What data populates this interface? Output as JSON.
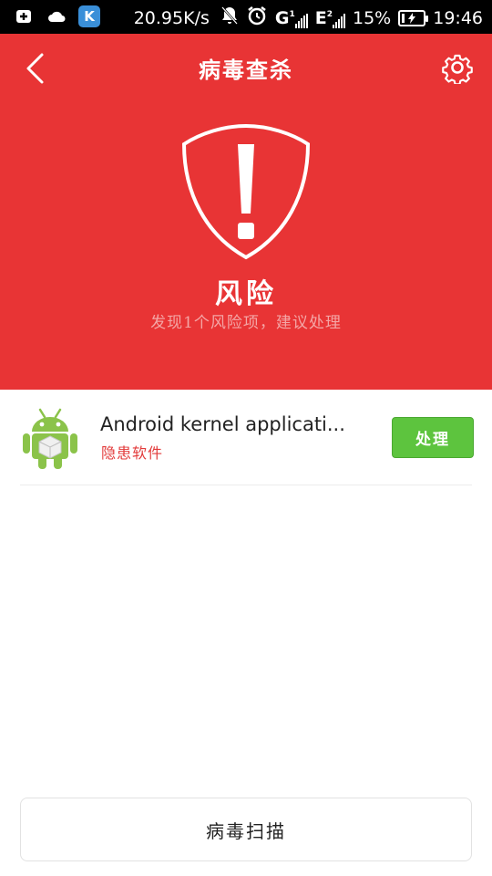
{
  "status_bar": {
    "net_speed": "20.95K/s",
    "network_1": "G",
    "network_2": "E",
    "sim_1": "1",
    "sim_2": "2",
    "battery": "15%",
    "time": "19:46",
    "app_badge": "K"
  },
  "header": {
    "title": "病毒查杀",
    "risk_label": "风险",
    "risk_desc": "发现1个风险项，建议处理"
  },
  "risk_items": [
    {
      "name": "Android kernel applicati...",
      "tag": "隐患软件",
      "action_label": "处理"
    }
  ],
  "bottom": {
    "scan_label": "病毒扫描"
  },
  "colors": {
    "header_bg": "#e83435",
    "action_green": "#5dc43e",
    "tag_red": "#e23a3a"
  }
}
